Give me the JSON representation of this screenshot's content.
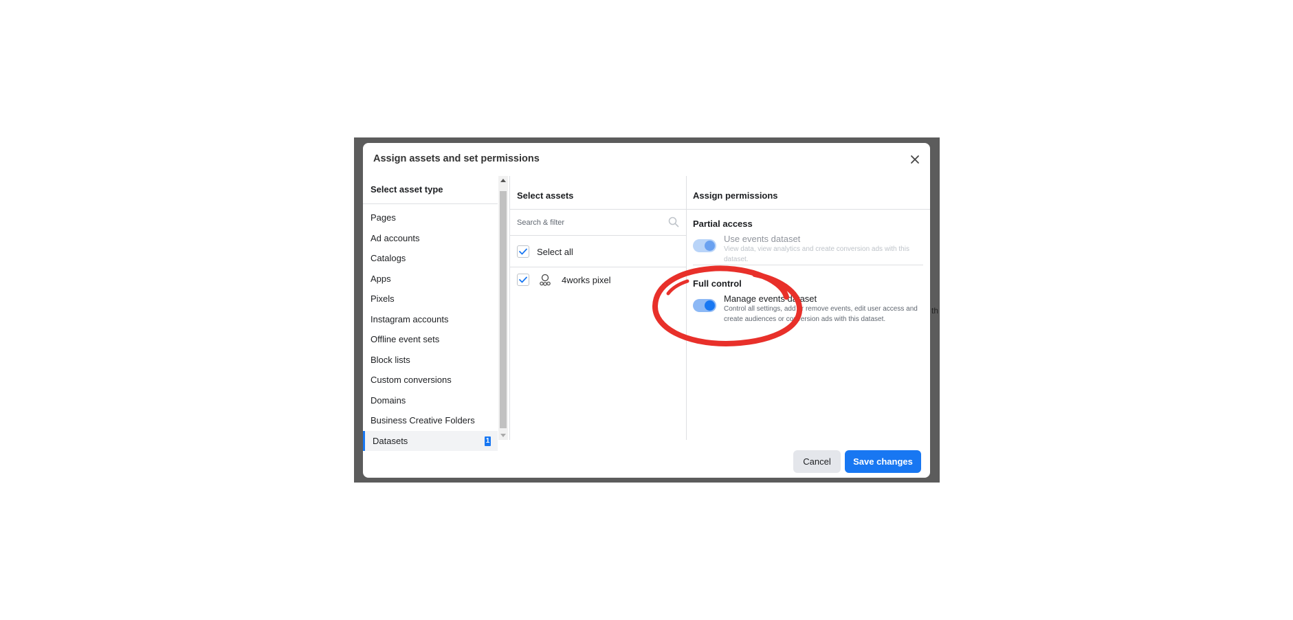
{
  "background_text": "th",
  "modal": {
    "title": "Assign assets and set permissions"
  },
  "asset_types": {
    "header": "Select asset type",
    "items": [
      {
        "label": "Pages"
      },
      {
        "label": "Ad accounts"
      },
      {
        "label": "Catalogs"
      },
      {
        "label": "Apps"
      },
      {
        "label": "Pixels"
      },
      {
        "label": "Instagram accounts"
      },
      {
        "label": "Offline event sets"
      },
      {
        "label": "Block lists"
      },
      {
        "label": "Custom conversions"
      },
      {
        "label": "Domains"
      },
      {
        "label": "Business Creative Folders"
      },
      {
        "label": "Datasets",
        "selected": true,
        "badge": "1"
      }
    ]
  },
  "assets": {
    "header": "Select assets",
    "search_placeholder": "Search & filter",
    "select_all_label": "Select all",
    "select_all_checked": true,
    "items": [
      {
        "label": "4works pixel",
        "checked": true,
        "icon": "pixel-icon"
      }
    ]
  },
  "permissions": {
    "header": "Assign permissions",
    "partial": {
      "title": "Partial access",
      "option_title": "Use events dataset",
      "option_desc": "View data, view analytics and create conversion ads with this dataset.",
      "enabled": true,
      "disabled": true
    },
    "full": {
      "title": "Full control",
      "option_title": "Manage events dataset",
      "option_desc": "Control all settings, add or remove events, edit user access and create audiences or conversion ads with this dataset.",
      "enabled": true
    }
  },
  "footer": {
    "cancel_label": "Cancel",
    "save_label": "Save changes"
  },
  "colors": {
    "accent": "#1877f2",
    "annotation": "#e8302a"
  }
}
